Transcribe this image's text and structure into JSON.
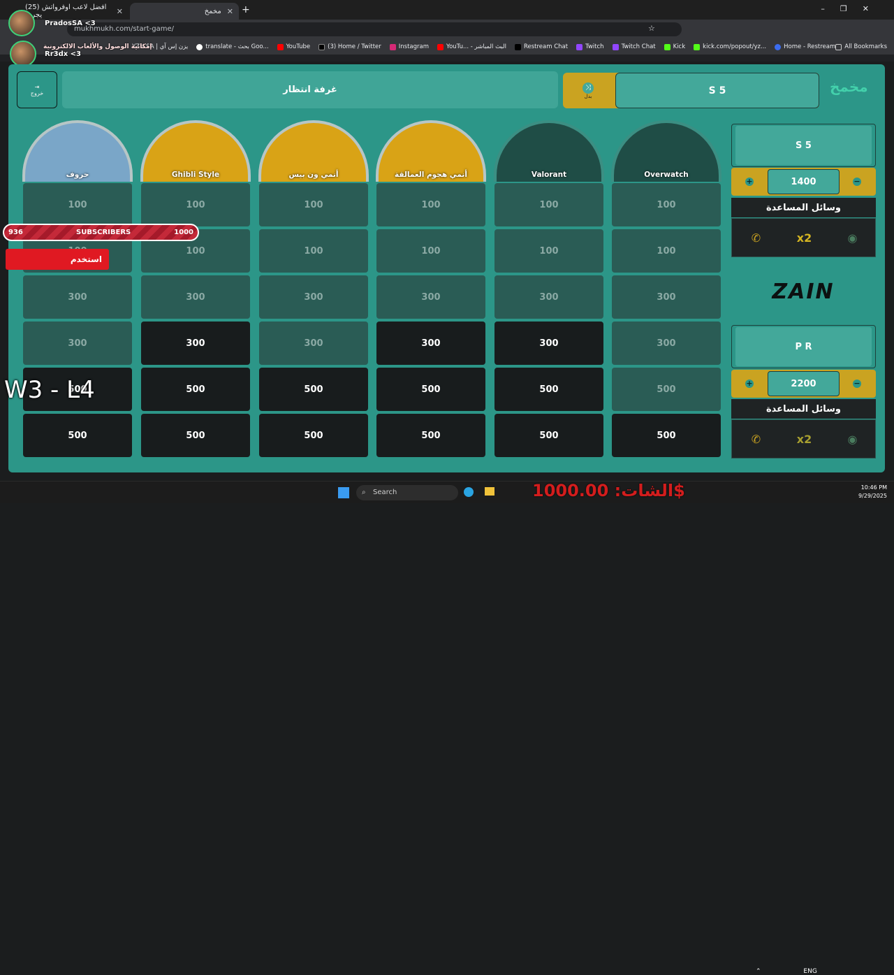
{
  "browser": {
    "tabs": [
      {
        "title": "(25) افضل لاعب اوفرواتش يجرب"
      },
      {
        "title": "مخمخ",
        "active": true
      }
    ],
    "url": "mukhmukh.com/start-game/",
    "bookmarks": [
      "YZN SA | يزن إس آي",
      "translate - بحث Goo...",
      "YouTube",
      "(3) Home / Twitter",
      "Instagram",
      "YouTu... - البث المباشر",
      "Restream Chat",
      "Twitch",
      "Twitch Chat",
      "Kick",
      "kick.com/popout/yz...",
      "Home - Restream"
    ],
    "all_bookmarks": "All Bookmarks"
  },
  "stream": {
    "user1": "PradosSA <3",
    "user2": "Rr3dx <3",
    "overlay_text": "إمكانية الوصول والألعاب الالكترونية",
    "subs_current": "936",
    "subs_label": "SUBSCRIBERS",
    "subs_goal": "1000",
    "use_btn": "استخدم",
    "score_text": "W3 - L4",
    "chat_text": "الشات: 1000.00$"
  },
  "game": {
    "exit_label": "خروج",
    "waiting_room": "غرفة انتظار",
    "swap_label": "بدل",
    "top_team": "S 5",
    "logo": "مخمخ",
    "categories": [
      {
        "title": "حروف"
      },
      {
        "title": "Ghibli Style"
      },
      {
        "title": "أنمي ون بيس"
      },
      {
        "title": "أنمي هجوم العمالقة"
      },
      {
        "title": "Valorant"
      },
      {
        "title": "Overwatch"
      }
    ],
    "rows": [
      [
        "100",
        "100",
        "100",
        "100",
        "100",
        "100"
      ],
      [
        "100",
        "100",
        "100",
        "100",
        "100",
        "100"
      ],
      [
        "300",
        "300",
        "300",
        "300",
        "300",
        "300"
      ],
      [
        "300",
        "300",
        "300",
        "300",
        "300",
        "300"
      ],
      [
        "500",
        "500",
        "500",
        "500",
        "500",
        "500"
      ],
      [
        "500",
        "500",
        "500",
        "500",
        "500",
        "500"
      ]
    ],
    "active": [
      [
        false,
        false,
        false,
        false,
        false,
        false
      ],
      [
        false,
        false,
        false,
        false,
        false,
        false
      ],
      [
        false,
        false,
        false,
        false,
        false,
        false
      ],
      [
        false,
        true,
        false,
        true,
        true,
        false
      ],
      [
        true,
        true,
        true,
        true,
        true,
        false
      ],
      [
        true,
        true,
        true,
        true,
        true,
        true
      ]
    ],
    "teams": [
      {
        "name": "S 5",
        "score": "1400",
        "help_title": "وسائل المساعدة",
        "plus": "+",
        "minus": "−",
        "help_x2": "x2"
      },
      {
        "name": "P R",
        "score": "2200",
        "help_title": "وسائل المساعدة",
        "plus": "+",
        "minus": "−",
        "help_x2": "x2"
      }
    ],
    "sponsor": "ZAIN"
  },
  "taskbar": {
    "search": "Search",
    "lang": "ENG",
    "time": "10:46 PM",
    "date": "9/29/2025"
  }
}
